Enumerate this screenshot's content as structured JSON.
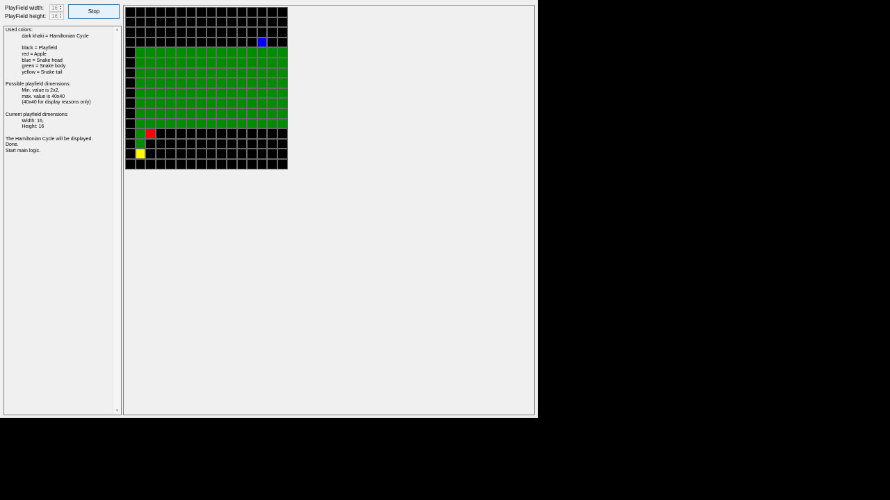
{
  "controls": {
    "width_label": "PlayField width:",
    "height_label": "PlayField height:",
    "width_value": "16",
    "height_value": "16",
    "stop_label": "Stop"
  },
  "log": {
    "text": "Used colors:\n            dark khaki = Hamiltonian Cycle\n\n            black = Playfield\n            red = Apple\n            blue = Snake head\n            green = Snake body\n            yellow = Snake tail\n\nPossible playfield dimensions:\n            Min. value is 2x2,\n            max. value is 40x40\n            (40x40 for display reasons only)\n\nCurrent playfield dimensions:\n            Width: 16,\n            Height: 16\n\nThe Hamiltonian Cycle will be displayed.\nDone.\nStart main logic."
  },
  "colors": {
    "playfield": "#000000",
    "apple": "#ff0000",
    "head": "#0000ff",
    "body": "#008c00",
    "tail": "#ffff00"
  },
  "playfield": {
    "cols": 16,
    "rows": 16,
    "grid": [
      "0000000000000000",
      "0000000000000000",
      "0000000000000000",
      "0000000000000H00",
      "0BBBBBBBBBBBBBBB",
      "0BBBBBBBBBBBBBBB",
      "0BBBBBBBBBBBBBBB",
      "0BBBBBBBBBBBBBBB",
      "0BBBBBBBBBBBBBBB",
      "0BBBBBBBBBBBBBBB",
      "0BBBBBBBBBBBBBBB",
      "0BBBBBBBBBBBBBBB",
      "0BA0000000000000",
      "0B00000000000000",
      "0T00000000000000",
      "0000000000000000"
    ]
  }
}
